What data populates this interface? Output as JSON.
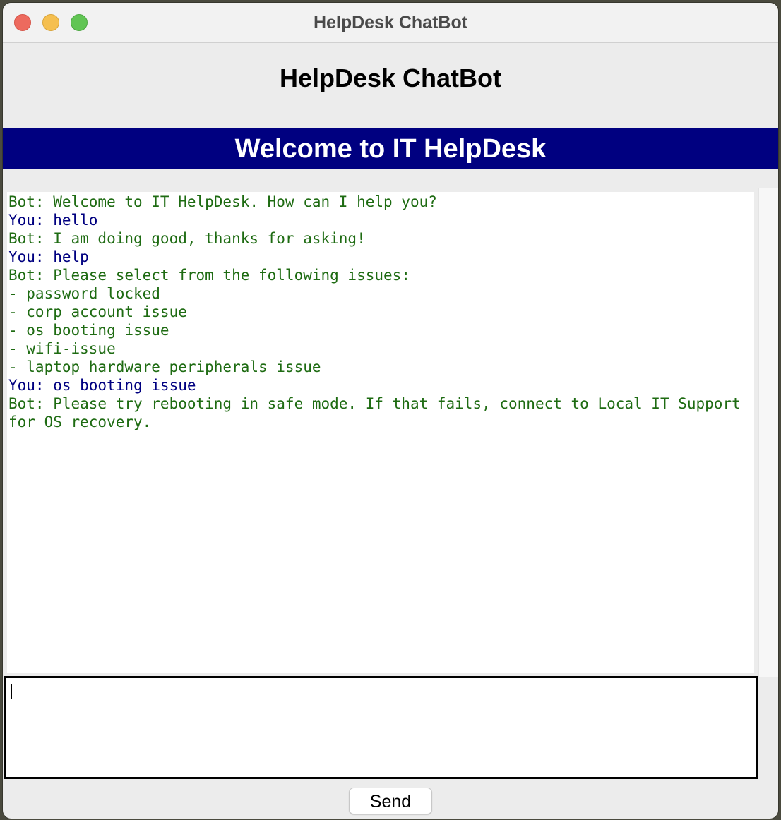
{
  "window": {
    "title": "HelpDesk ChatBot"
  },
  "app": {
    "heading": "HelpDesk ChatBot",
    "banner": "Welcome to IT HelpDesk",
    "banner_color": "#000080"
  },
  "chat": {
    "bot_color": "#1e6b12",
    "user_color": "#000080",
    "lines": [
      {
        "speaker": "bot",
        "text": "Bot: Welcome to IT HelpDesk. How can I help you?"
      },
      {
        "speaker": "user",
        "text": "You: hello"
      },
      {
        "speaker": "bot",
        "text": "Bot: I am doing good, thanks for asking!"
      },
      {
        "speaker": "user",
        "text": "You: help"
      },
      {
        "speaker": "bot",
        "text": "Bot: Please select from the following issues:"
      },
      {
        "speaker": "bot",
        "text": "- password locked"
      },
      {
        "speaker": "bot",
        "text": "- corp account issue"
      },
      {
        "speaker": "bot",
        "text": "- os booting issue"
      },
      {
        "speaker": "bot",
        "text": "- wifi-issue"
      },
      {
        "speaker": "bot",
        "text": "- laptop hardware peripherals issue"
      },
      {
        "speaker": "user",
        "text": "You: os booting issue"
      },
      {
        "speaker": "bot",
        "text": "Bot: Please try rebooting in safe mode. If that fails, connect to Local IT Support for OS recovery."
      }
    ]
  },
  "input": {
    "value": ""
  },
  "actions": {
    "send_label": "Send"
  }
}
